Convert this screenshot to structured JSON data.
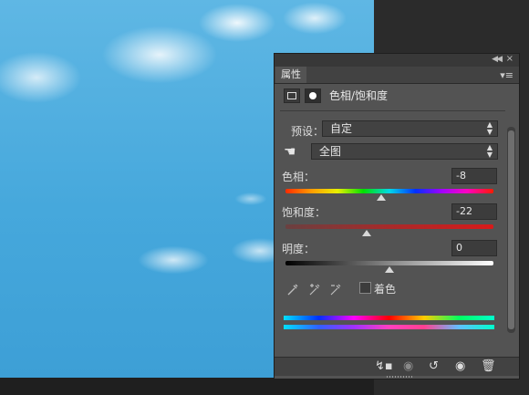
{
  "panel": {
    "tab_label": "属性",
    "adjustment_title": "色相/饱和度",
    "preset": {
      "label": "预设：",
      "value": "自定"
    },
    "channel": {
      "value": "全图"
    },
    "hue": {
      "label": "色相：",
      "value": "-8",
      "slider_fraction": 0.46
    },
    "saturation": {
      "label": "饱和度：",
      "value": "-22",
      "slider_fraction": 0.39
    },
    "lightness": {
      "label": "明度：",
      "value": "0",
      "slider_fraction": 0.5
    },
    "colorize": {
      "label": "着色",
      "checked": false
    }
  },
  "icons": {
    "collapse": "collapse-panel-icon",
    "close": "close-icon",
    "menu": "panel-menu-icon",
    "hue_saturation": "hue-saturation-adjustment-icon",
    "mask": "layer-mask-icon",
    "hand": "on-image-adjust-hand-icon",
    "eyedropper": "eyedropper-icon",
    "eyedropper_add": "eyedropper-add-icon",
    "eyedropper_subtract": "eyedropper-subtract-icon",
    "clip": "clip-to-layer-icon",
    "view_previous": "view-previous-state-icon",
    "reset": "reset-icon",
    "visibility": "eye-icon",
    "delete": "trash-icon"
  },
  "colors": {
    "panel_bg": "#535353",
    "workspace_bg": "#2b2b2b",
    "sky": "#46a8dc"
  }
}
